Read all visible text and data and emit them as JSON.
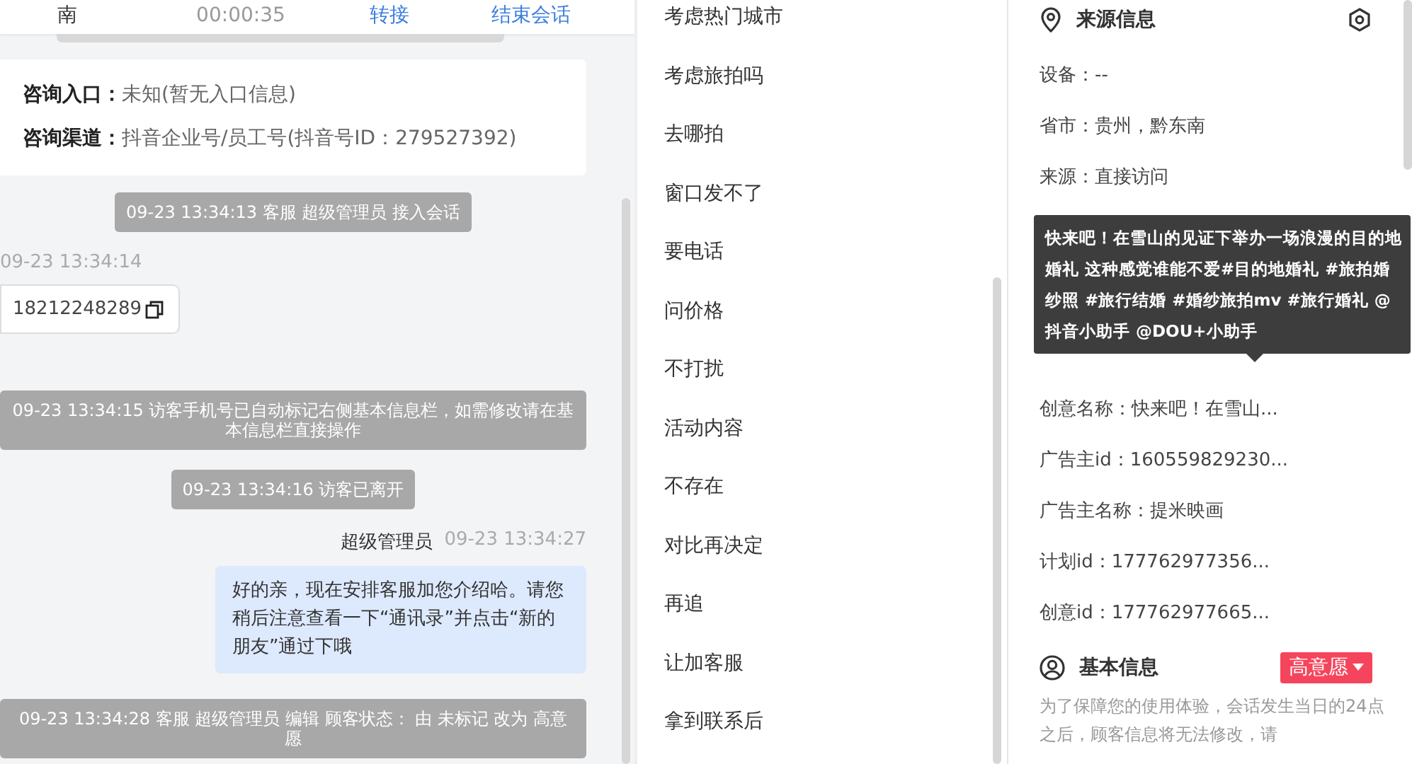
{
  "call_bar": {
    "name": "南",
    "duration": "00:00:35",
    "actions": [
      "转接",
      "结束会话"
    ]
  },
  "entry_card": {
    "rows": [
      {
        "label": "咨询入口：",
        "value": "未知(暂无入口信息)"
      },
      {
        "label": "咨询渠道：",
        "value": "抖音企业号/员工号(抖音号ID：279527392)"
      }
    ]
  },
  "messages": [
    {
      "kind": "system",
      "text": "09-23 13:34:13 客服 超级管理员 接入会话"
    },
    {
      "kind": "visitor",
      "time": "09-23 13:34:14",
      "text": "18212248289"
    },
    {
      "kind": "system",
      "text": "09-23 13:34:15 访客手机号已自动标记右侧基本信息栏，如需修改请在基本信息栏直接操作"
    },
    {
      "kind": "system",
      "text": "09-23 13:34:16 访客已离开"
    },
    {
      "kind": "agent",
      "name": "超级管理员",
      "time": "09-23 13:34:27",
      "text": "好的亲，现在安排客服加您介绍哈。请您稍后注意查看一下“通讯录”并点击“新的朋友”通过下哦"
    },
    {
      "kind": "system",
      "text": "09-23 13:34:28 客服 超级管理员 编辑 顾客状态： 由 未标记 改为 高意愿"
    }
  ],
  "quick_replies": [
    "考虑热门城市",
    "考虑旅拍吗",
    "去哪拍",
    "窗口发不了",
    "要电话",
    "问价格",
    "不打扰",
    "活动内容",
    "不存在",
    "对比再决定",
    "再追",
    "让加客服",
    "拿到联系后"
  ],
  "source_info": {
    "title": "来源信息",
    "rows_top": [
      "设备：--",
      "省市：贵州，黔东南",
      "来源：直接访问"
    ],
    "tooltip": "快来吧！在雪山的见证下举办一场浪漫的目的地婚礼 这种感觉谁能不爱#目的地婚礼 #旅拍婚纱照 #旅行结婚 #婚纱旅拍mv #旅行婚礼 @抖音小助手 @DOU+小助手",
    "rows_bottom": [
      "创意名称：快来吧！在雪山...",
      "广告主id：160559829230...",
      "广告主名称：提米映画",
      "计划id：177762977356...",
      "创意id：177762977665..."
    ]
  },
  "basic_info": {
    "title": "基本信息",
    "status_tag": "高意愿",
    "notice": "为了保障您的使用体验，会话发生当日的24点之后，顾客信息将无法修改，请"
  }
}
